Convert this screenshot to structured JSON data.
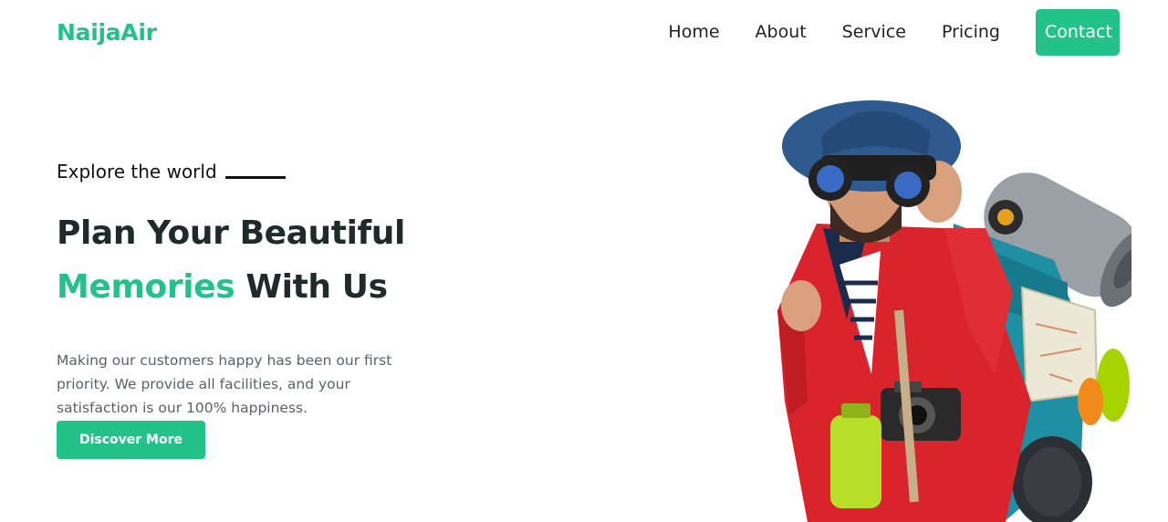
{
  "brand": {
    "name": "NaijaAir",
    "accent_color": "#23c28b"
  },
  "nav": {
    "items": [
      {
        "label": "Home"
      },
      {
        "label": "About"
      },
      {
        "label": "Service"
      },
      {
        "label": "Pricing"
      }
    ],
    "contact_label": "Contact"
  },
  "hero": {
    "eyebrow": "Explore the world",
    "headline_line1": "Plan Your Beautiful",
    "headline_accent": "Memories",
    "headline_rest": " With Us",
    "description": "Making our customers happy has been our first priority. We provide all facilities, and your satisfaction is our 100% happiness.",
    "cta_label": "Discover More",
    "image_subject": "traveler-with-binoculars"
  }
}
